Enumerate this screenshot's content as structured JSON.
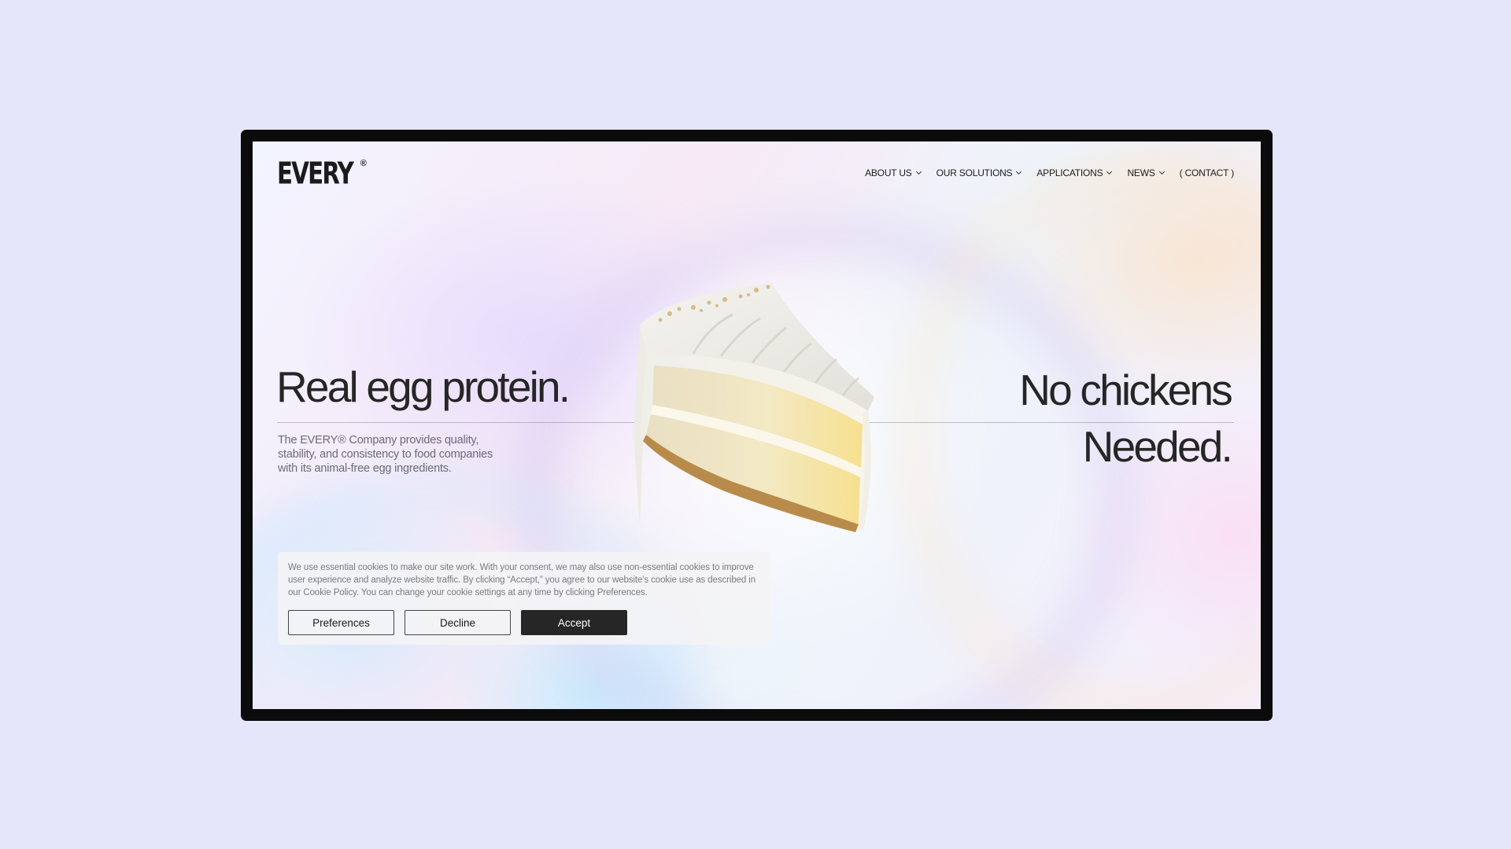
{
  "brand": {
    "name": "EVERY",
    "reg_mark": "®"
  },
  "nav": {
    "items": [
      {
        "label": "ABOUT US",
        "has_dropdown": true
      },
      {
        "label": "OUR SOLUTIONS",
        "has_dropdown": true
      },
      {
        "label": "APPLICATIONS",
        "has_dropdown": true
      },
      {
        "label": "NEWS",
        "has_dropdown": true
      },
      {
        "label": "( CONTACT )",
        "has_dropdown": false
      }
    ]
  },
  "hero": {
    "headline_left": "Real egg protein.",
    "headline_right_line1": "No chickens",
    "headline_right_line2": "Needed.",
    "subcopy": "The EVERY® Company provides quality, stability, and consistency to food companies with its animal-free egg ingredients.",
    "image": "cake-slice"
  },
  "cookie_banner": {
    "text": "We use essential cookies to make our site work. With your consent, we may also use non-essential cookies to improve user experience and analyze website traffic. By clicking “Accept,” you agree to our website's cookie use as described in our Cookie Policy. You can change your cookie settings at any time by clicking Preferences.",
    "preferences_label": "Preferences",
    "decline_label": "Decline",
    "accept_label": "Accept"
  },
  "colors": {
    "page_background": "#e6e6fb",
    "frame": "#0b0b0b",
    "text_dark": "#262626",
    "accept_button": "#262626"
  }
}
